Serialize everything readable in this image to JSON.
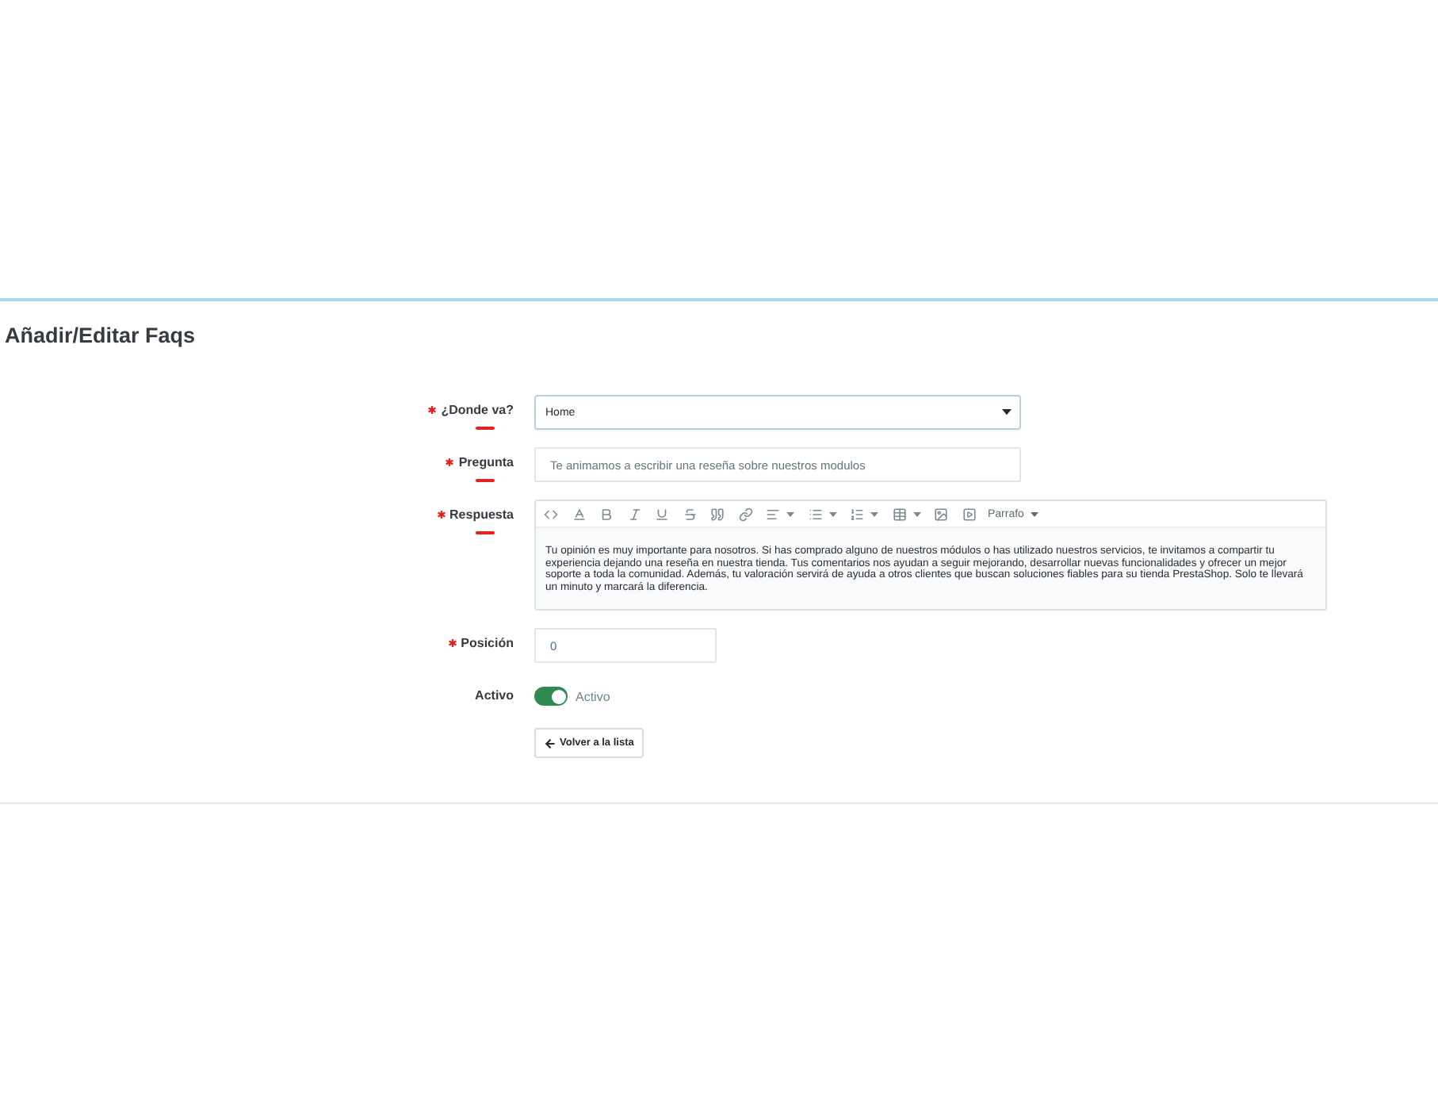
{
  "page": {
    "title": "Añadir/Editar Faqs"
  },
  "form": {
    "fields": [
      {
        "kind": "select",
        "label": "¿Donde va?",
        "required": true,
        "marked": true,
        "value": "Home"
      },
      {
        "kind": "text",
        "label": "Pregunta",
        "required": true,
        "marked": true,
        "value": "Te animamos a escribir una reseña sobre nuestros modulos"
      },
      {
        "kind": "editor",
        "label": "Respuesta",
        "required": true,
        "marked": true,
        "format": "Parrafo",
        "value": "Tu opinión es muy importante para nosotros. Si has comprado alguno de nuestros módulos o has utilizado nuestros servicios, te invitamos a compartir tu experiencia dejando una reseña en nuestra tienda. Tus comentarios nos ayudan a seguir mejorando, desarrollar nuevas funcionalidades y ofrecer un mejor soporte a toda la comunidad. Además, tu valoración servirá de ayuda a otros clientes que buscan soluciones fiables para su tienda PrestaShop. Solo te llevará un minuto y marcará la diferencia."
      },
      {
        "kind": "number",
        "label": "Posición",
        "required": true,
        "marked": false,
        "value": "0"
      },
      {
        "kind": "toggle",
        "label": "Activo",
        "required": false,
        "marked": false,
        "on": true,
        "state_label": "Activo"
      }
    ],
    "back_button": {
      "label": "Volver a la lista"
    }
  }
}
